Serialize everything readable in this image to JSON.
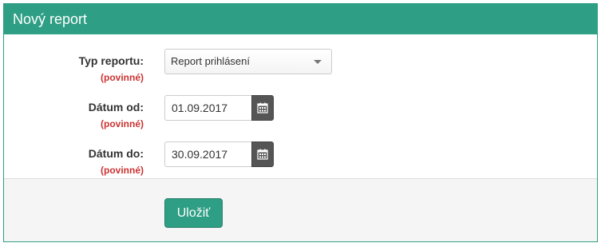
{
  "panel": {
    "title": "Nový report"
  },
  "form": {
    "report_type": {
      "label": "Typ reportu:",
      "required": "(povinné)",
      "selected": "Report prihlásení",
      "icon": "chevron-down-icon"
    },
    "date_from": {
      "label": "Dátum od:",
      "required": "(povinné)",
      "value": "01.09.2017",
      "icon": "calendar-icon"
    },
    "date_to": {
      "label": "Dátum do:",
      "required": "(povinné)",
      "value": "30.09.2017",
      "icon": "calendar-icon"
    }
  },
  "footer": {
    "save_label": "Uložiť"
  },
  "colors": {
    "accent": "#2e9e84",
    "required": "#cc3333",
    "calendar_button": "#555555",
    "footer_bg": "#f5f5f5"
  }
}
